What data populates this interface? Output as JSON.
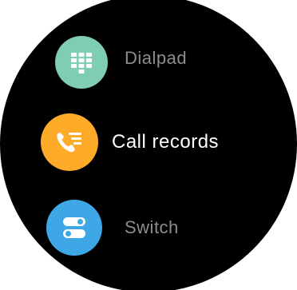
{
  "menu": {
    "items": [
      {
        "label": "Dialpad",
        "icon": "dialpad-icon",
        "color": "#7fcdb3",
        "state": "dimmed"
      },
      {
        "label": "Call records",
        "icon": "call-records-icon",
        "color": "#ffab2a",
        "state": "selected"
      },
      {
        "label": "Switch",
        "icon": "switch-icon",
        "color": "#3ea8e6",
        "state": "dimmed"
      }
    ]
  },
  "colors": {
    "background": "#000000",
    "selected_text": "#ffffff",
    "dimmed_text": "#8d8d8d"
  }
}
